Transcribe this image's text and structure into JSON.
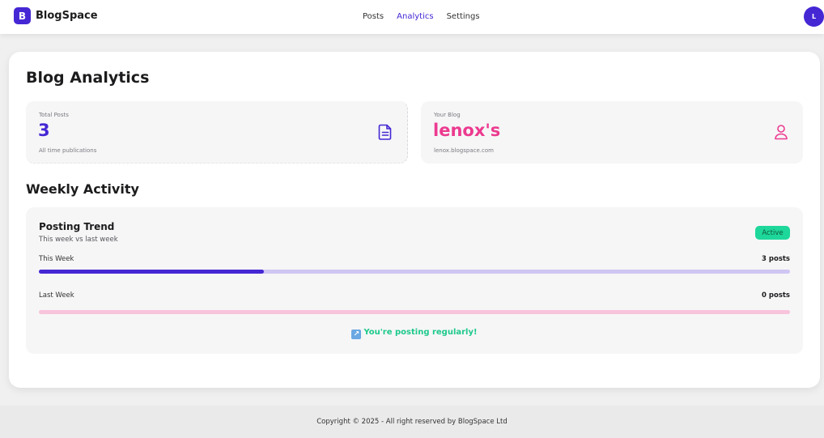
{
  "brand": {
    "logo_letter": "B",
    "name": "BlogSpace"
  },
  "nav": {
    "items": [
      {
        "label": "Posts",
        "active": false
      },
      {
        "label": "Analytics",
        "active": true
      },
      {
        "label": "Settings",
        "active": false
      }
    ]
  },
  "user": {
    "avatar_initial": "L"
  },
  "page": {
    "title": "Blog Analytics"
  },
  "stats": {
    "total_posts": {
      "label": "Total Posts",
      "value": "3",
      "sub": "All time publications",
      "icon": "document-icon"
    },
    "your_blog": {
      "label": "Your Blog",
      "value": "lenox's",
      "sub": "lenox.blogspace.com",
      "icon": "user-icon"
    }
  },
  "weekly": {
    "section_title": "Weekly Activity",
    "card_title": "Posting Trend",
    "card_subtitle": "This week vs last week",
    "badge": "Active",
    "this_week": {
      "label": "This Week",
      "value": "3 posts",
      "fill": 0.3
    },
    "last_week": {
      "label": "Last Week",
      "value": "0 posts",
      "fill": 0
    },
    "message_icon": "↗",
    "message": "You're posting regularly!"
  },
  "footer": {
    "text": "Copyright © 2025 - All right reserved by BlogSpace Ltd"
  },
  "colors": {
    "primary": "#4527d4",
    "accent": "#ec3a8f",
    "success": "#1ed79a"
  }
}
